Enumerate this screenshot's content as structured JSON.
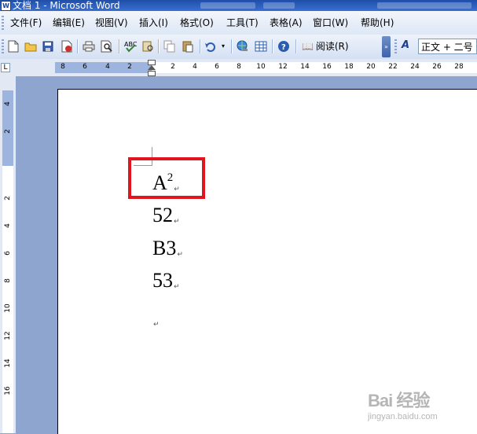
{
  "window": {
    "title": "文档 1 - Microsoft Word",
    "icon_glyph": "W"
  },
  "menu": [
    {
      "label": "文件(F)"
    },
    {
      "label": "编辑(E)"
    },
    {
      "label": "视图(V)"
    },
    {
      "label": "插入(I)"
    },
    {
      "label": "格式(O)"
    },
    {
      "label": "工具(T)"
    },
    {
      "label": "表格(A)"
    },
    {
      "label": "窗口(W)"
    },
    {
      "label": "帮助(H)"
    }
  ],
  "toolbar": {
    "read_label": "阅读(R)",
    "style_value": "正文 + 二号",
    "icons": [
      "new-icon",
      "open-icon",
      "save-icon",
      "permission-icon",
      "print-icon",
      "print-preview-icon",
      "spelling-icon",
      "research-icon",
      "copy-icon",
      "paste-icon",
      "undo-icon",
      "hyperlink-icon",
      "table-icon",
      "help-icon",
      "read-icon",
      "styles-icon"
    ]
  },
  "ruler": {
    "h_labels": [
      "8",
      "6",
      "4",
      "2",
      "2",
      "4",
      "6",
      "8",
      "10",
      "12",
      "14",
      "16",
      "18",
      "20",
      "22",
      "24",
      "26",
      "28"
    ],
    "v_labels": [
      "4",
      "2",
      "2",
      "4",
      "6",
      "8",
      "10",
      "12",
      "14",
      "16"
    ]
  },
  "document": {
    "lines": [
      {
        "base": "A",
        "sup": "2",
        "mark": "↵"
      },
      {
        "base": "52",
        "sup": "",
        "mark": "↵"
      },
      {
        "base": "B3",
        "sup": "",
        "mark": "↵"
      },
      {
        "base": "53",
        "sup": "",
        "mark": "↵"
      },
      {
        "base": "",
        "sup": "",
        "mark": "↵"
      }
    ]
  },
  "highlight_color": "#e0161e",
  "watermark": {
    "logo": "Bai 经验",
    "url": "jingyan.baidu.com"
  }
}
